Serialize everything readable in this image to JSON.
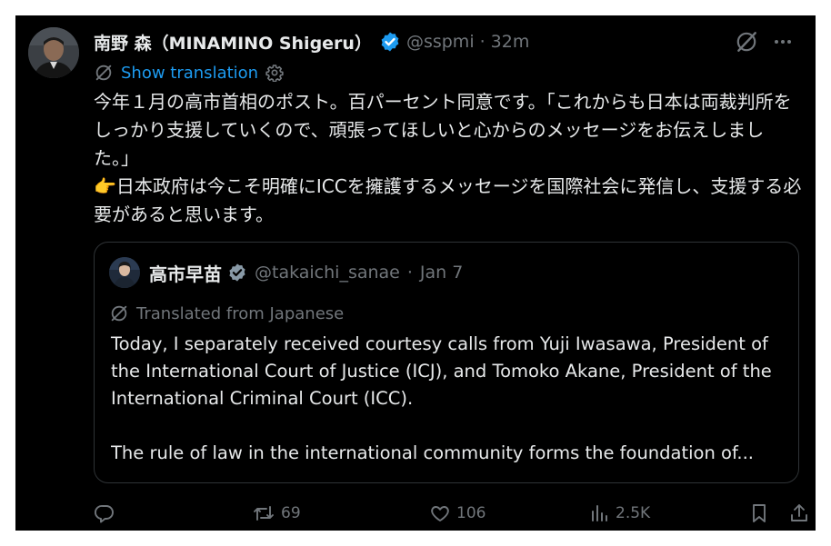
{
  "post": {
    "author_name": "南野 森（MINAMINO Shigeru）",
    "handle": "@sspmi",
    "separator": "·",
    "time": "32m",
    "show_translation": "Show translation",
    "body": "今年１月の高市首相のポスト。百パーセント同意です。「これからも日本は両裁判所をしっかり支援していくので、頑張ってほしいと心からのメッセージをお伝えしました。」\n👉日本政府は今こそ明確にICCを擁護するメッセージを国際社会に発信し、支援する必要があると思います。"
  },
  "quote": {
    "author_name": "高市早苗",
    "handle": "@takaichi_sanae",
    "separator": "·",
    "date": "Jan 7",
    "translated_label": "Translated from Japanese",
    "paragraph1": "Today, I separately received courtesy calls from Yuji Iwasawa, President of the International Court of Justice (ICJ), and Tomoko Akane, President of the International Criminal Court (ICC).",
    "paragraph2": "The rule of law in the international community forms the foundation of..."
  },
  "actions": {
    "reposts": "69",
    "likes": "106",
    "views": "2.5K"
  },
  "colors": {
    "background": "#000000",
    "text": "#e7e9ea",
    "muted": "#71767b",
    "accent": "#1d9bf0",
    "border": "#2f3336"
  },
  "icons": [
    "verified-badge-icon",
    "grok-icon",
    "more-icon",
    "translate-icon",
    "gear-icon",
    "reply-icon",
    "repost-icon",
    "like-icon",
    "views-icon",
    "bookmark-icon",
    "share-icon"
  ]
}
